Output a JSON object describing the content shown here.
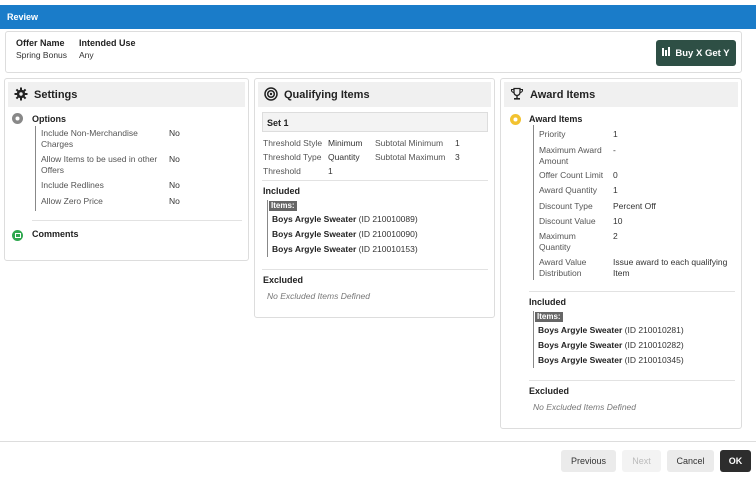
{
  "topbar": {
    "title": "Review"
  },
  "header": {
    "offer_name_label": "Offer Name",
    "offer_name_value": "Spring Bonus",
    "intended_use_label": "Intended Use",
    "intended_use_value": "Any",
    "promo_button_label": "Buy X Get Y",
    "promo_button_icon": "bar-chart-icon"
  },
  "settings": {
    "title": "Settings",
    "options_label": "Options",
    "rows": [
      {
        "label": "Include Non-Merchandise Charges",
        "value": "No"
      },
      {
        "label": "Allow Items to be used in other Offers",
        "value": "No"
      },
      {
        "label": "Include Redlines",
        "value": "No"
      },
      {
        "label": "Allow Zero Price",
        "value": "No"
      }
    ],
    "comments_label": "Comments"
  },
  "qualifying": {
    "title": "Qualifying Items",
    "set_label": "Set 1",
    "threshold_style_label": "Threshold Style",
    "threshold_style_value": "Minimum",
    "subtotal_minimum_label": "Subtotal Minimum",
    "subtotal_minimum_value": "1",
    "threshold_type_label": "Threshold Type",
    "threshold_type_value": "Quantity",
    "subtotal_maximum_label": "Subtotal Maximum",
    "subtotal_maximum_value": "3",
    "threshold_label": "Threshold",
    "threshold_value": "1",
    "included_label": "Included",
    "items_tag": "Items:",
    "items": [
      {
        "name": "Boys Argyle Sweater",
        "id": "(ID 210010089)"
      },
      {
        "name": "Boys Argyle Sweater",
        "id": "(ID 210010090)"
      },
      {
        "name": "Boys Argyle Sweater",
        "id": "(ID 210010153)"
      }
    ],
    "excluded_label": "Excluded",
    "excluded_empty": "No Excluded Items Defined"
  },
  "award": {
    "title": "Award Items",
    "section_label": "Award Items",
    "rows": [
      {
        "label": "Priority",
        "value": "1"
      },
      {
        "label": "Maximum Award Amount",
        "value": "-"
      },
      {
        "label": "Offer Count Limit",
        "value": "0"
      },
      {
        "label": "Award Quantity",
        "value": "1"
      },
      {
        "label": "Discount Type",
        "value": "Percent Off"
      },
      {
        "label": "Discount Value",
        "value": "10"
      },
      {
        "label": "Maximum Quantity",
        "value": "2"
      },
      {
        "label": "Award Value Distribution",
        "value": "Issue award to each qualifying Item"
      }
    ],
    "included_label": "Included",
    "items_tag": "Items:",
    "items": [
      {
        "name": "Boys Argyle Sweater",
        "id": "(ID 210010281)"
      },
      {
        "name": "Boys Argyle Sweater",
        "id": "(ID 210010282)"
      },
      {
        "name": "Boys Argyle Sweater",
        "id": "(ID 210010345)"
      }
    ],
    "excluded_label": "Excluded",
    "excluded_empty": "No Excluded Items Defined"
  },
  "footer": {
    "previous": "Previous",
    "next": "Next",
    "cancel": "Cancel",
    "ok": "OK"
  },
  "colors": {
    "topbar": "#1a7cc9",
    "promo_button": "#2e4f45",
    "ok_button": "#2d2d2d"
  }
}
